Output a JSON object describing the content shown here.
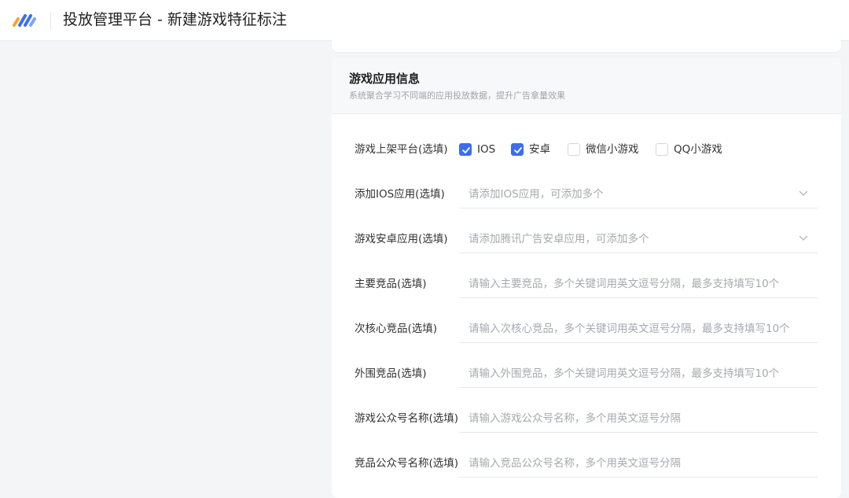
{
  "header": {
    "title": "投放管理平台 - 新建游戏特征标注",
    "logo_icon": "brand-logo-icon"
  },
  "section": {
    "title": "游戏应用信息",
    "subtitle": "系统聚合学习不同端的应用投放数据，提升广告拿量效果"
  },
  "form": {
    "platform": {
      "label": "游戏上架平台(选填)",
      "options": [
        {
          "label": "IOS",
          "checked": true
        },
        {
          "label": "安卓",
          "checked": true
        },
        {
          "label": "微信小游戏",
          "checked": false
        },
        {
          "label": "QQ小游戏",
          "checked": false
        }
      ]
    },
    "ios_app": {
      "label": "添加IOS应用(选填)",
      "placeholder": "请添加IOS应用，可添加多个"
    },
    "android_app": {
      "label": "游戏安卓应用(选填)",
      "placeholder": "请添加腾讯广告安卓应用，可添加多个"
    },
    "main_competitors": {
      "label": "主要竞品(选填)",
      "placeholder": "请输入主要竞品，多个关键词用英文逗号分隔，最多支持填写10个"
    },
    "secondary_competitors": {
      "label": "次核心竞品(选填)",
      "placeholder": "请输入次核心竞品，多个关键词用英文逗号分隔，最多支持填写10个"
    },
    "peripheral_competitors": {
      "label": "外围竞品(选填)",
      "placeholder": "请输入外围竞品，多个关键词用英文逗号分隔，最多支持填写10个"
    },
    "game_official_accounts": {
      "label": "游戏公众号名称(选填)",
      "placeholder": "请输入游戏公众号名称，多个用英文逗号分隔"
    },
    "competitor_official_accounts": {
      "label": "竞品公众号名称(选填)",
      "placeholder": "请输入竞品公众号名称，多个用英文逗号分隔"
    }
  },
  "colors": {
    "accent": "#3b6df2",
    "placeholder": "#a6a9ae",
    "background": "#f4f5f7"
  }
}
